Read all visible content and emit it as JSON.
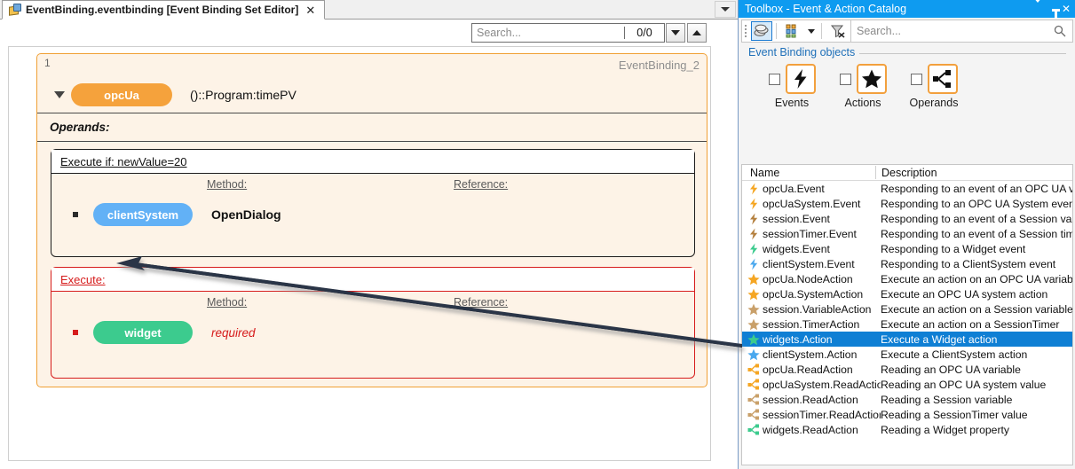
{
  "editor": {
    "tab": {
      "icon": "event-binding-file-icon",
      "title": "EventBinding.eventbinding [Event Binding Set Editor]",
      "close_label": "✕"
    },
    "tab_overflow_icon": "chevron-down-icon",
    "search": {
      "placeholder": "Search...",
      "value": "",
      "match_count": "0/0",
      "prev_icon": "chevron-up-icon",
      "next_icon": "chevron-down-icon"
    },
    "binding": {
      "index": "1",
      "name": "EventBinding_2",
      "expander_icon": "triangle-down-icon",
      "event_pill": "opcUa",
      "event_path": "()::Program:timePV",
      "operands_label": "Operands:",
      "condition_block": {
        "header": "Execute if: newValue=20",
        "method_column": "Method:",
        "reference_column": "Reference:",
        "operand_pill": "clientSystem",
        "method_value": "OpenDialog",
        "reference_value": ""
      },
      "execute_block": {
        "header": "Execute:",
        "method_column": "Method:",
        "reference_column": "Reference:",
        "operand_pill": "widget",
        "method_value": "required",
        "reference_value": ""
      }
    }
  },
  "toolbox": {
    "title": "Toolbox - Event & Action Catalog",
    "titlebar_buttons": [
      {
        "name": "dropdown-icon",
        "label": "▼"
      },
      {
        "name": "pin-icon",
        "label": "✕"
      }
    ],
    "close_label": "✕",
    "toolbar": {
      "objects_icon": "show-objects-icon",
      "group_icon": "group-list-icon",
      "group_dropdown_icon": "chevron-down-icon",
      "filter_icon": "clear-filter-icon",
      "search_placeholder": "Search...",
      "search_value": "",
      "search_icon": "search-icon"
    },
    "group": {
      "title": "Event Binding objects",
      "items": [
        {
          "label": "Events",
          "icon": "lightning-bolt-icon",
          "checked": false
        },
        {
          "label": "Actions",
          "icon": "star-icon",
          "checked": false
        },
        {
          "label": "Operands",
          "icon": "node-tree-icon",
          "checked": false
        }
      ]
    },
    "list": {
      "columns": [
        "Name",
        "Description"
      ],
      "rows": [
        {
          "name": "opcUa.Event",
          "description": "Responding to an event of an OPC UA variab",
          "icon": "lightning-bolt-icon",
          "color": "#f5a623",
          "selected": false
        },
        {
          "name": "opcUaSystem.Event",
          "description": "Responding to an OPC UA System event",
          "icon": "lightning-bolt-icon",
          "color": "#f5a623",
          "selected": false
        },
        {
          "name": "session.Event",
          "description": "Responding to an event of a Session variable",
          "icon": "lightning-bolt-icon",
          "color": "#b4803f",
          "selected": false
        },
        {
          "name": "sessionTimer.Event",
          "description": "Responding to an event of a Session timer",
          "icon": "lightning-bolt-icon",
          "color": "#b4803f",
          "selected": false
        },
        {
          "name": "widgets.Event",
          "description": "Responding to a Widget event",
          "icon": "lightning-bolt-icon",
          "color": "#3ccb8e",
          "selected": false
        },
        {
          "name": "clientSystem.Event",
          "description": "Responding to a ClientSystem event",
          "icon": "lightning-bolt-icon",
          "color": "#4aa8ee",
          "selected": false
        },
        {
          "name": "opcUa.NodeAction",
          "description": "Execute an action on an OPC UA variable",
          "icon": "star-icon",
          "color": "#f5a623",
          "selected": false
        },
        {
          "name": "opcUa.SystemAction",
          "description": "Execute an OPC UA system action",
          "icon": "star-icon",
          "color": "#f5a623",
          "selected": false
        },
        {
          "name": "session.VariableAction",
          "description": "Execute an action on a Session variable",
          "icon": "star-icon",
          "color": "#c9a06a",
          "selected": false
        },
        {
          "name": "session.TimerAction",
          "description": "Execute an action on a SessionTimer",
          "icon": "star-icon",
          "color": "#c9a06a",
          "selected": false
        },
        {
          "name": "widgets.Action",
          "description": "Execute a Widget action",
          "icon": "star-icon",
          "color": "#3ccb8e",
          "selected": true
        },
        {
          "name": "clientSystem.Action",
          "description": "Execute a ClientSystem action",
          "icon": "star-icon",
          "color": "#4aa8ee",
          "selected": false
        },
        {
          "name": "opcUa.ReadAction",
          "description": "Reading an OPC UA variable",
          "icon": "node-tree-icon",
          "color": "#f5a623",
          "selected": false
        },
        {
          "name": "opcUaSystem.ReadAction",
          "description": "Reading an OPC UA system value",
          "icon": "node-tree-icon",
          "color": "#f5a623",
          "selected": false
        },
        {
          "name": "session.ReadAction",
          "description": "Reading a Session variable",
          "icon": "node-tree-icon",
          "color": "#c9a06a",
          "selected": false
        },
        {
          "name": "sessionTimer.ReadAction",
          "description": "Reading a SessionTimer value",
          "icon": "node-tree-icon",
          "color": "#c9a06a",
          "selected": false
        },
        {
          "name": "widgets.ReadAction",
          "description": "Reading a Widget property",
          "icon": "node-tree-icon",
          "color": "#3ccb8e",
          "selected": false
        }
      ]
    }
  },
  "annotation": {
    "arrow_icon": "pointer-arrow",
    "from": "widgets.Action",
    "to": "Execute:"
  },
  "colors": {
    "accent_orange": "#f0a035",
    "selection_blue": "#0f7fd4",
    "error_red": "#d61c1c",
    "title_blue": "#0e9bf0"
  }
}
